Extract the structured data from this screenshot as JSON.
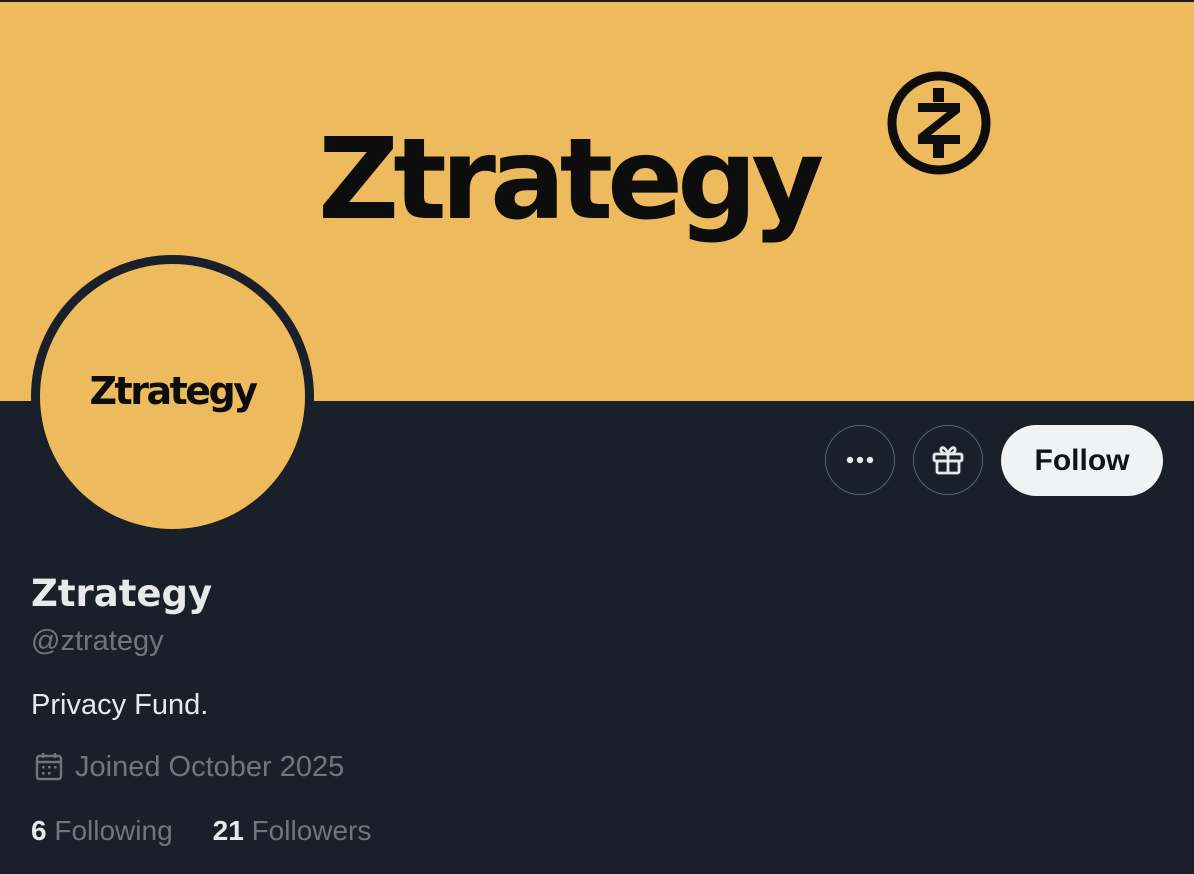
{
  "banner": {
    "wordmark": "Ztrategy",
    "color": "#edbb5d"
  },
  "avatar": {
    "wordmark": "Ztrategy"
  },
  "actions": {
    "more_icon": "more-horizontal-icon",
    "gift_icon": "gift-icon",
    "follow_label": "Follow"
  },
  "profile": {
    "display_name": "Ztrategy",
    "handle": "@ztrategy",
    "bio": "Privacy Fund.",
    "joined": "Joined October 2025",
    "joined_icon": "calendar-icon"
  },
  "stats": {
    "following_count": "6",
    "following_label": "Following",
    "followers_count": "21",
    "followers_label": "Followers"
  },
  "colors": {
    "background": "#19202a",
    "text_primary": "#e7e9ea",
    "text_secondary": "#71767b",
    "follow_button_bg": "#eff3f4"
  }
}
